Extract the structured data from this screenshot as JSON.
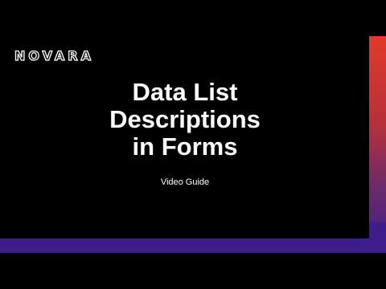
{
  "brand": {
    "logo_text": "NOVARA"
  },
  "slide": {
    "title_lines": [
      "Data List",
      "Descriptions",
      "in Forms"
    ],
    "subtitle": "Video Guide"
  },
  "colors": {
    "background": "#000000",
    "text": "#ffffff",
    "accent_red": "#e23a2a",
    "accent_purple": "#3d1d8a"
  }
}
